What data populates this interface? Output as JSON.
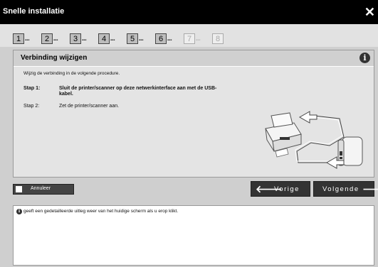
{
  "window": {
    "title": "Snelle installatie",
    "close_glyph": "✕"
  },
  "steps": [
    {
      "number": "1",
      "dots": "▪▪▪",
      "active": true
    },
    {
      "number": "2",
      "dots": "▪▪▪",
      "active": true
    },
    {
      "number": "3",
      "dots": "▪▪▪",
      "active": true
    },
    {
      "number": "4",
      "dots": "▪▪▪",
      "active": true
    },
    {
      "number": "5",
      "dots": "▪▪▪",
      "active": true
    },
    {
      "number": "6",
      "dots": "▪▪▪",
      "active": true
    },
    {
      "number": "7",
      "dots": "▪▪▪",
      "active": false
    },
    {
      "number": "8",
      "dots": "",
      "active": false
    }
  ],
  "panel": {
    "title": "Verbinding wijzigen",
    "info_glyph": "i",
    "instruction": "Wijzig de verbinding in de volgende procedure.",
    "steps": [
      {
        "label": "Stap 1:",
        "text": "Sluit de printer/scanner op deze netwerkinterface aan met de USB-kabel."
      },
      {
        "label": "Stap 2:",
        "text": "Zet de printer/scanner aan."
      }
    ]
  },
  "buttons": {
    "cancel": "Annuleer",
    "previous": "Vorige",
    "next": "Volgende",
    "prev_arrow": "🡐",
    "next_arrow": "🡒"
  },
  "help": {
    "icon_glyph": "i",
    "text": "geeft een gedetailleerde uitleg weer van het huidige scherm als u erop klikt."
  },
  "colors": {
    "titlebar": "#000000",
    "panel": "#e4e4e4",
    "background": "#cfcfcf"
  }
}
